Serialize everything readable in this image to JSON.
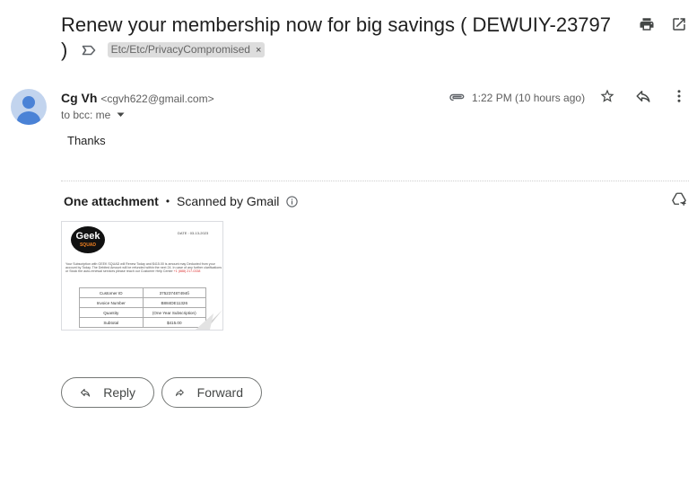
{
  "email": {
    "subject": "Renew your membership now for big savings ( DEWUIY-23797 )",
    "label": "Etc/Etc/PrivacyCompromised",
    "label_remove": "×",
    "sender_name": "Cg Vh",
    "sender_email": "<cgvh622@gmail.com>",
    "recipients": "to bcc: me",
    "time": "1:22 PM (10 hours ago)",
    "body": "Thanks"
  },
  "attachments": {
    "count_label": "One attachment",
    "separator": "•",
    "scan_label": "Scanned by Gmail",
    "thumbnail": {
      "logo_line1": "Geek",
      "logo_line2": "SQUAD",
      "date": "DATE : 03-13-2023",
      "paragraph": "Your Subscription with GEEK SQUAD will Renew Today and $415.00 is amount may Deducted from your account by Today. The Debited Amount will be refunded within the next 24. In case of any further clarifications or Stock the auto-renewal services please reach our Customer Help Center",
      "phone": "+1 (888) 217-0338",
      "rows": [
        {
          "k": "Customer ID",
          "v": "375237487494б"
        },
        {
          "k": "Invoice Number",
          "v": "B884DE11326"
        },
        {
          "k": "Quantity",
          "v": "(One Year Subscription)"
        },
        {
          "k": "Subtotal",
          "v": "$415.00"
        }
      ]
    }
  },
  "actions": {
    "reply_label": "Reply",
    "forward_label": "Forward"
  },
  "icons": {
    "print": "printer-icon",
    "open_new": "open-in-new-window-icon",
    "label_tag": "label-outline-icon",
    "attachment": "paperclip-icon",
    "star": "star-outline-icon",
    "reply": "reply-icon",
    "more": "more-vertical-icon",
    "dropdown": "caret-down-icon",
    "info": "info-icon",
    "add_to_drive": "add-to-drive-icon",
    "forward": "forward-icon"
  },
  "colors": {
    "label_chip_bg": "#dddddd",
    "avatar_bg": "#c2d4ee",
    "avatar_fg": "#4a82d6",
    "button_border": "#747775"
  }
}
